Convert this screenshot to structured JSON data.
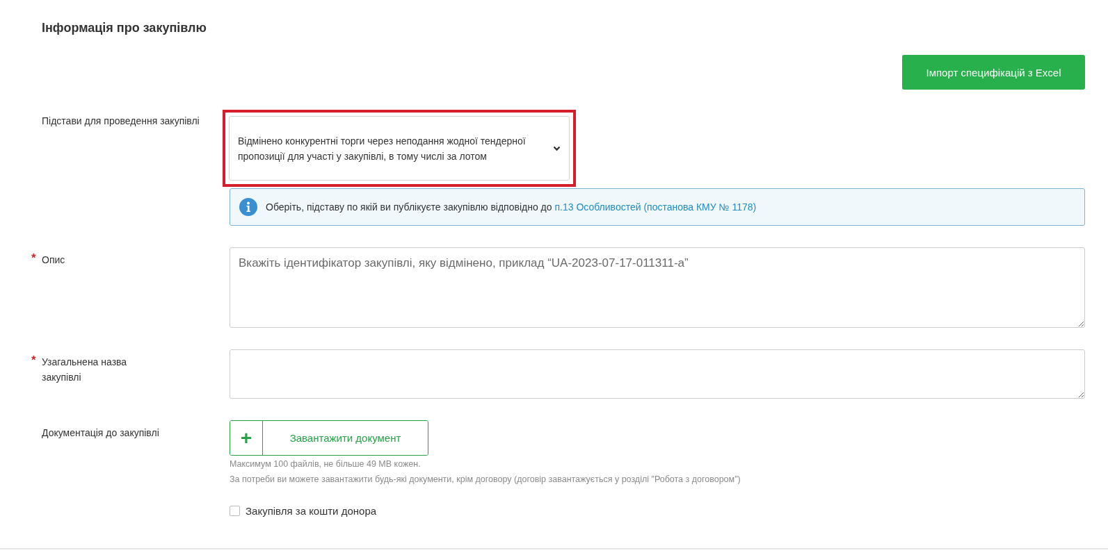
{
  "section_title": "Інформація про закупівлю",
  "import_button": "Імпорт специфікацій з Excel",
  "basis": {
    "label": "Підстави для проведення закупівлі",
    "value": "Відмінено конкурентні торги через неподання жодної тендерної пропозиції для участі у закупівлі, в тому числі за лотом",
    "highlighted": true
  },
  "info": {
    "text": "Оберіть, підставу по якій ви публікуєте закупівлю відповідно до",
    "link": "п.13 Особливостей (постанова КМУ № 1178)"
  },
  "description": {
    "label": "Опис",
    "required_mark": "*",
    "placeholder": "Вкажіть ідентифікатор закупівлі, яку відмінено, приклад “UA-2023-07-17-011311-a”"
  },
  "general_name": {
    "label": "Узагальнена назва закупівлі",
    "required_mark": "*"
  },
  "documents": {
    "label": "Документація до закупівлі",
    "plus": "+",
    "button": "Завантажити документ",
    "hints": [
      "Максимум 100 файлів, не більше 49 MB кожен.",
      "За потреби ви можете завантажити будь-які документи, крім договору (договір завантажується у розділі \"Робота з договором\")"
    ]
  },
  "donor": {
    "label": "Закупівля за кошти донора",
    "checked": false
  }
}
